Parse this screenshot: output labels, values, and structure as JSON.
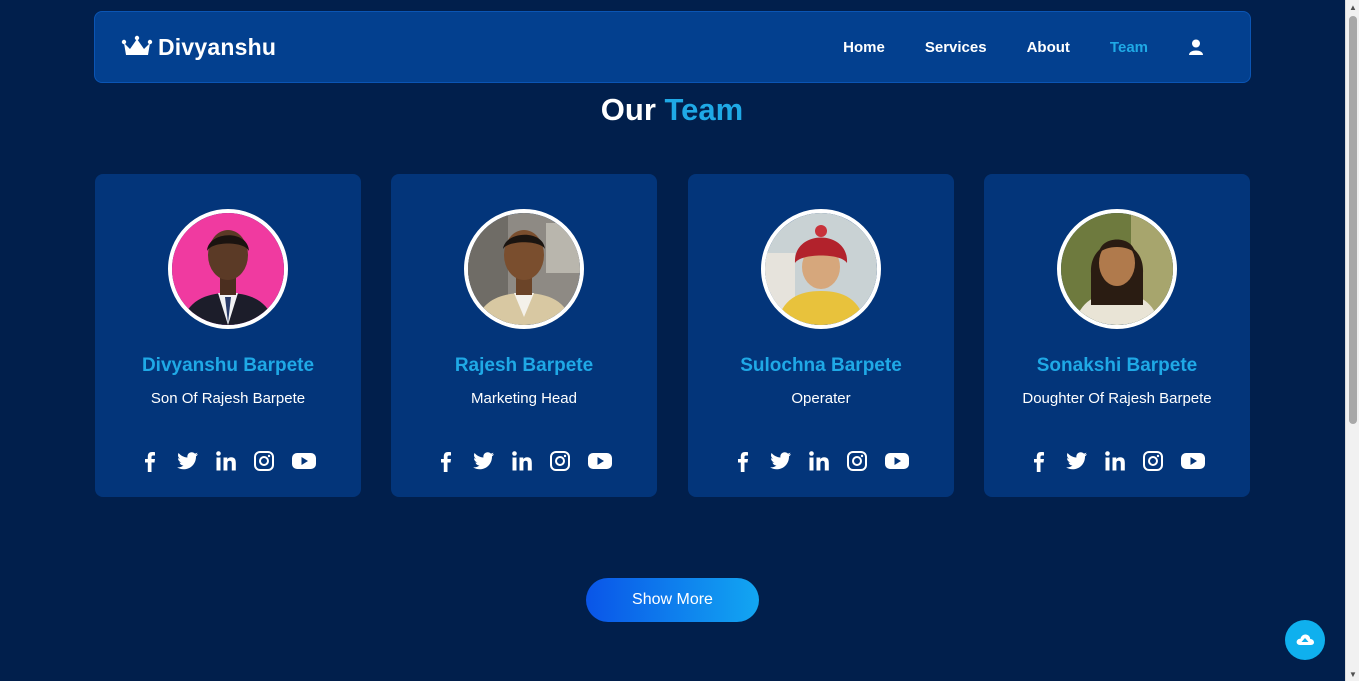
{
  "brand": {
    "name": "Divyanshu",
    "icon": "crown-icon"
  },
  "nav": {
    "items": [
      {
        "label": "Home",
        "active": false
      },
      {
        "label": "Services",
        "active": false
      },
      {
        "label": "About",
        "active": false
      },
      {
        "label": "Team",
        "active": true
      }
    ],
    "user_icon": "user-icon"
  },
  "section": {
    "title_main": "Our",
    "title_accent": "Team"
  },
  "team": [
    {
      "name": "Divyanshu Barpete",
      "role": "Son Of Rajesh Barpete"
    },
    {
      "name": "Rajesh Barpete",
      "role": "Marketing Head"
    },
    {
      "name": "Sulochna Barpete",
      "role": "Operater"
    },
    {
      "name": "Sonakshi Barpete",
      "role": "Doughter Of Rajesh Barpete"
    }
  ],
  "socials": [
    "facebook-icon",
    "twitter-icon",
    "linkedin-icon",
    "instagram-icon",
    "youtube-icon"
  ],
  "show_more": "Show More",
  "colors": {
    "background": "#011f4c",
    "nav": "#03408f",
    "card": "#03357a",
    "accent": "#1fa9e6"
  }
}
